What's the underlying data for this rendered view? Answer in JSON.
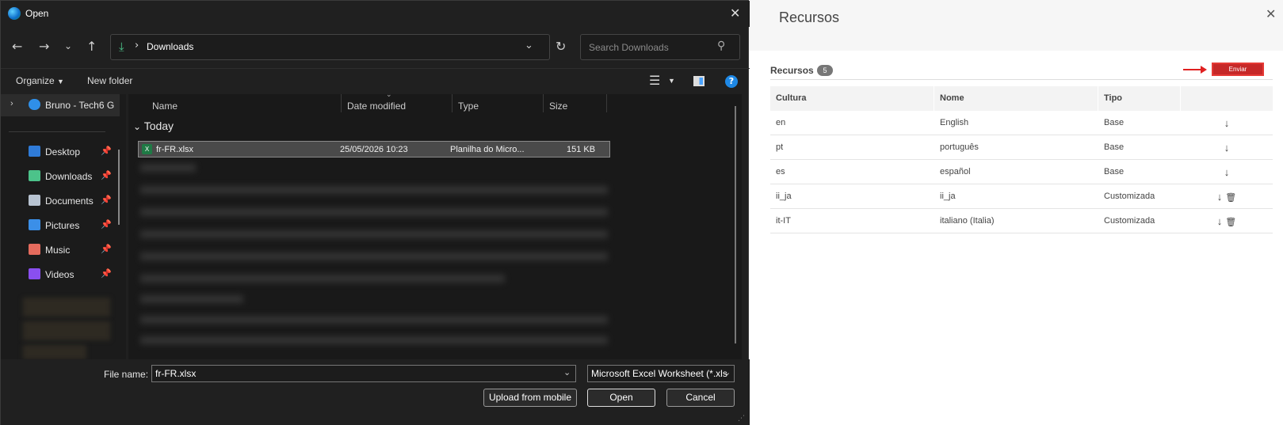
{
  "dialog": {
    "title": "Open",
    "address": {
      "current": "Downloads"
    },
    "search": {
      "placeholder": "Search Downloads"
    },
    "toolbar": {
      "organize": "Organize",
      "new_folder": "New folder",
      "help": "?"
    },
    "sidebar": {
      "onedrive": "Bruno - Tech6 G",
      "items": [
        {
          "label": "Desktop",
          "color": "#2f7bd8"
        },
        {
          "label": "Downloads",
          "color": "#4cc38a"
        },
        {
          "label": "Documents",
          "color": "#b8c3d1"
        },
        {
          "label": "Pictures",
          "color": "#3b8fe8"
        },
        {
          "label": "Music",
          "color": "#e56b5d"
        },
        {
          "label": "Videos",
          "color": "#8a4ff0"
        }
      ]
    },
    "columns": {
      "name": "Name",
      "date": "Date modified",
      "type": "Type",
      "size": "Size"
    },
    "group": "Today",
    "selected_file": {
      "name": "fr-FR.xlsx",
      "date": "25/05/2026 10:23",
      "type": "Planilha do Micro...",
      "size": "151 KB"
    },
    "bottom": {
      "file_name_label": "File name:",
      "file_name_value": "fr-FR.xlsx",
      "file_type": "Microsoft Excel Worksheet (*.xls",
      "upload_from_mobile": "Upload from mobile",
      "open": "Open",
      "cancel": "Cancel"
    }
  },
  "panel": {
    "title": "Recursos",
    "section_title": "Recursos",
    "count": "5",
    "send_button": "Enviar",
    "columns": {
      "culture": "Cultura",
      "name": "Nome",
      "type": "Tipo"
    },
    "rows": [
      {
        "culture": "en",
        "name": "English",
        "type": "Base",
        "deletable": false
      },
      {
        "culture": "pt",
        "name": "português",
        "type": "Base",
        "deletable": false
      },
      {
        "culture": "es",
        "name": "español",
        "type": "Base",
        "deletable": false
      },
      {
        "culture": "ii_ja",
        "name": "ii_ja",
        "type": "Customizada",
        "deletable": true
      },
      {
        "culture": "it-IT",
        "name": "italiano (Italia)",
        "type": "Customizada",
        "deletable": true
      }
    ],
    "accent": "#c62828"
  }
}
